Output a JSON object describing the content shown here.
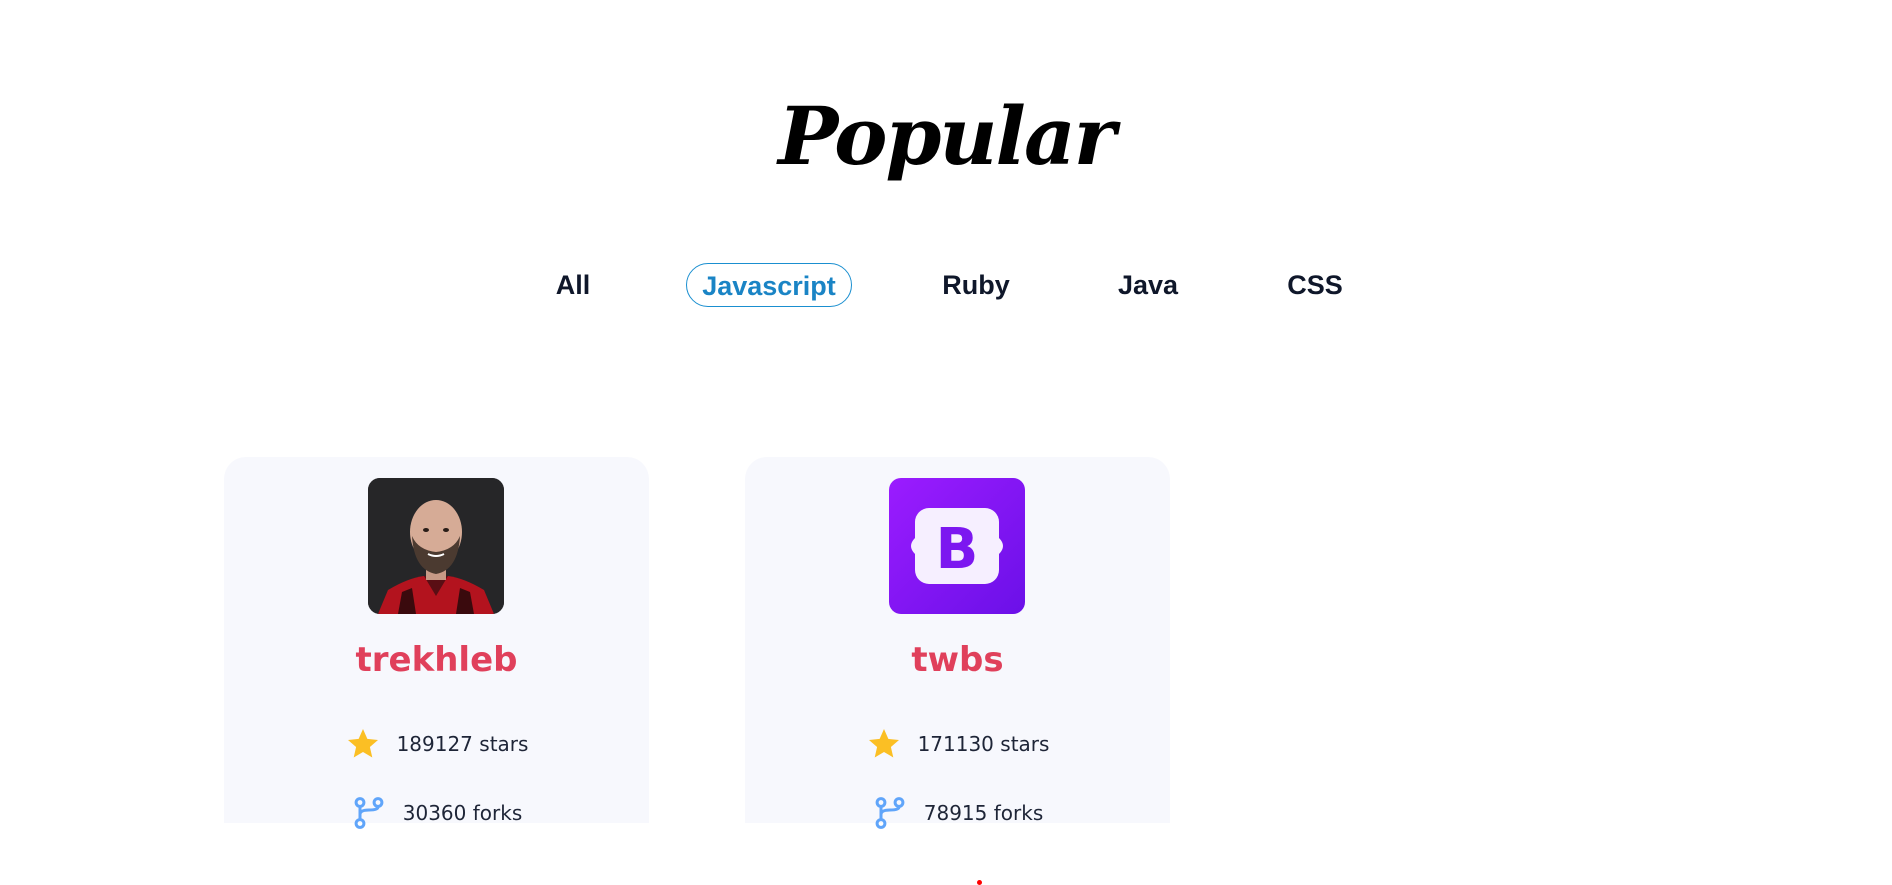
{
  "page": {
    "title": "Popular"
  },
  "tabs": [
    {
      "label": "All",
      "active": false
    },
    {
      "label": "Javascript",
      "active": true
    },
    {
      "label": "Ruby",
      "active": false
    },
    {
      "label": "Java",
      "active": false
    },
    {
      "label": "CSS",
      "active": false
    }
  ],
  "cards": [
    {
      "owner": "trekhleb",
      "stars": "189127 stars",
      "forks": "30360 forks",
      "avatar": "profile-photo"
    },
    {
      "owner": "twbs",
      "stars": "171130 stars",
      "forks": "78915 forks",
      "avatar": "bootstrap-logo"
    }
  ],
  "colors": {
    "accent_tab": "#1a84c5",
    "owner_name": "#e0405b",
    "star": "#fbbf24",
    "fork": "#60a5fa",
    "bootstrap_purple": "#7c17f0"
  }
}
